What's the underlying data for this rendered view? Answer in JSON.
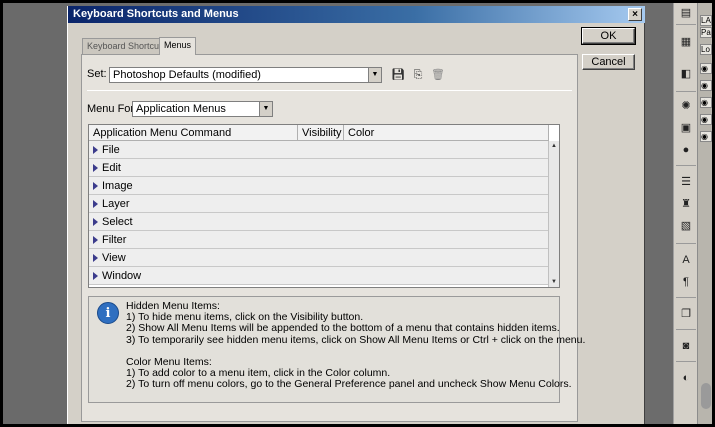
{
  "dialog": {
    "title": "Keyboard Shortcuts and Menus",
    "close": "×",
    "tabs": [
      "Keyboard Shortcuts",
      "Menus"
    ],
    "set_label": "Set:",
    "set_value": "Photoshop Defaults (modified)",
    "menu_for_label": "Menu For:",
    "menu_for_value": "Application Menus",
    "ok": "OK",
    "cancel": "Cancel"
  },
  "table": {
    "headers": [
      "Application Menu Command",
      "Visibility",
      "Color"
    ],
    "rows": [
      "File",
      "Edit",
      "Image",
      "Layer",
      "Select",
      "Filter",
      "View",
      "Window"
    ]
  },
  "info": {
    "icon": "i",
    "text": "Hidden Menu Items:\n1) To hide menu items, click on the Visibility button.\n2) Show All Menu Items will be appended to the bottom of a menu that contains hidden items.\n3) To temporarily see hidden menu items, click on Show All Menu Items or Ctrl + click on the menu.\n\nColor Menu Items:\n1) To add color to a menu item, click in the Color column.\n2) To turn off menu colors, go to the General Preference panel and uncheck Show Menu Colors."
  },
  "right_edge": {
    "labels": [
      "LA",
      "Pa",
      "Lo"
    ]
  },
  "colors": {
    "title_gradient_start": "#0a246a",
    "dialog_bg": "#d4d0c8",
    "info_icon": "#2f6fc0"
  }
}
